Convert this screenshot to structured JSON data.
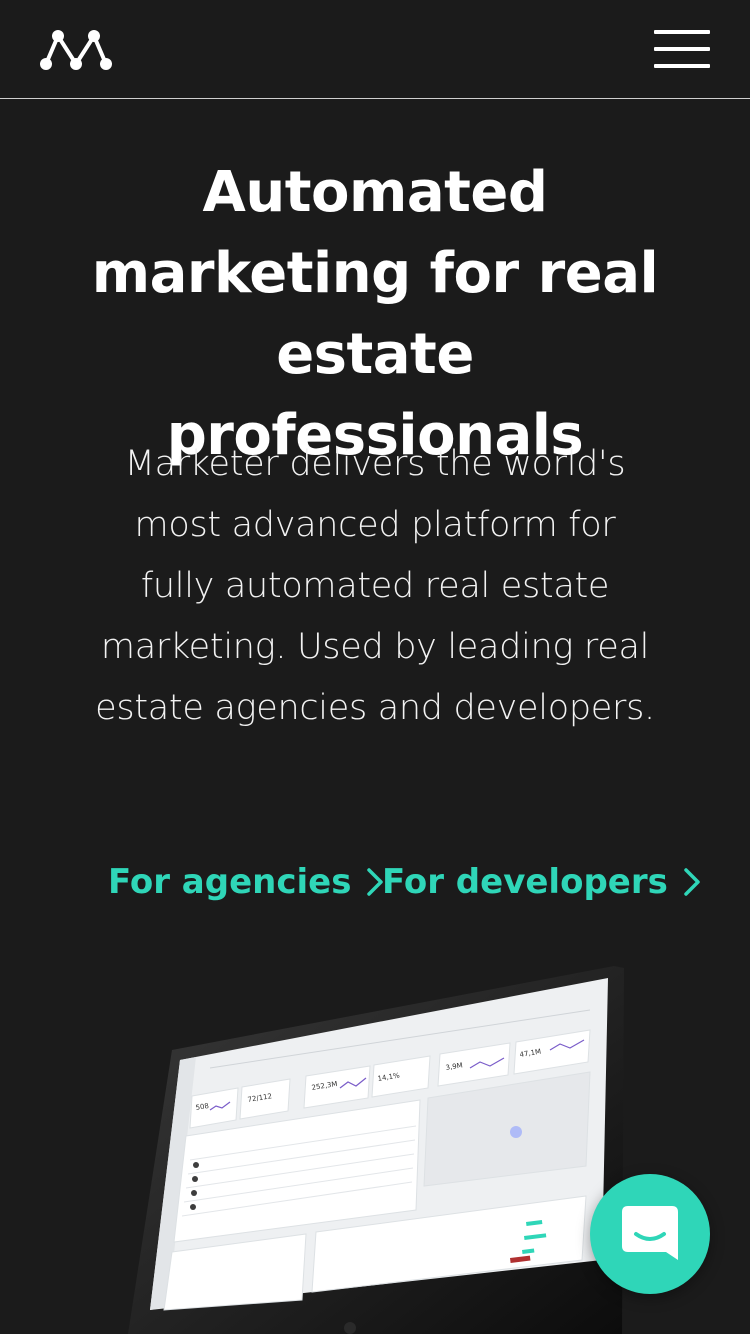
{
  "header": {
    "logo_icon": "marketer-m-logo",
    "menu_icon": "hamburger-menu-icon"
  },
  "hero": {
    "title": "Automated marketing for real estate professionals",
    "description": "Marketer delivers the world's most advanced platform for fully automated real estate marketing. Used by leading real estate agencies and developers."
  },
  "ctas": {
    "agencies_label": "For agencies",
    "developers_label": "For developers",
    "arrow_icon": "chevron-right-icon"
  },
  "chat": {
    "icon": "chat-bubble-icon"
  },
  "colors": {
    "background": "#1b1b1b",
    "accent": "#2fd6b8",
    "text": "#ffffff"
  }
}
